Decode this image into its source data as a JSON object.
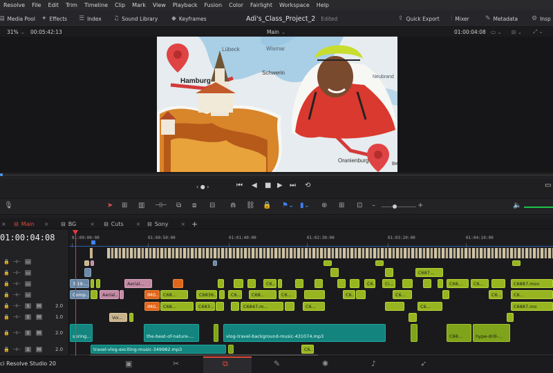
{
  "menu": [
    "Resolve",
    "File",
    "Edit",
    "Trim",
    "Timeline",
    "Clip",
    "Mark",
    "View",
    "Playback",
    "Fusion",
    "Color",
    "Fairlight",
    "Workspace",
    "Help"
  ],
  "toolbar": {
    "media_pool": "Media Pool",
    "effects": "Effects",
    "index": "Index",
    "sound_library": "Sound Library",
    "keyframes": "Keyframes",
    "project_name": "Adi's_Class_Project_2",
    "edited": "Edited",
    "quick_export": "Quick Export",
    "mixer": "Mixer",
    "metadata": "Metadata",
    "inspector": "Insp"
  },
  "viewer": {
    "zoom": "31%",
    "source_timecode": "00:05:42:13",
    "timeline_name": "Main",
    "record_timecode": "01:00:04:08"
  },
  "map": {
    "place_lubeck": "Lübeck",
    "place_wismar": "Wismar",
    "place_schwerin": "Schwerin",
    "place_hamburg": "Hamburg",
    "place_neubrandenburg": "Neubrand",
    "place_oranienburg": "Oranienburg",
    "place_be": "Be"
  },
  "tabs": [
    "Main",
    "BG",
    "Cuts",
    "Sony"
  ],
  "timeline": {
    "timecode": "01:00:04:08",
    "ruler": [
      "01:00:00:00",
      "01:00:50:00",
      "01:01:40:00",
      "01:02:30:00",
      "01:03:20:00",
      "01:04:10:00"
    ],
    "audio_levels": [
      "2.0",
      "1.0",
      "2.0",
      "2.0"
    ]
  },
  "clips": {
    "v3_1": "3 19-...",
    "v2_aerial": "Aerial...",
    "v2_c6": "C6...",
    "v2_ci": "Ci...",
    "v2_c6_b": "C6...",
    "v2_c68": "C68...",
    "v2_c6887": "C6887.mov",
    "v1_comp": "Comp...",
    "v1_aerial": "Aerial...",
    "v1_img": "IMG...",
    "v1_c68": "C68...",
    "v1_c6836": "C6836...",
    "v1_c6": "C6...",
    "v1_c68b": "C68...",
    "v1_c6c": "C6...",
    "v1_c6d": "C6...",
    "v1_c6e": "C6...",
    "v1_c6f": "C6...",
    "v1_c6g": "C6...",
    "a1_img": "IMG...",
    "a1_c68": "C68...",
    "a1_c683": "C683...",
    "a1_c6847": "C6847.m...",
    "a1_c6": "C6...",
    "a1_c6b": "C6...",
    "a1_c6887": "C6887.mo",
    "a2_voi": "Voi...",
    "a3_spring": "spring...",
    "a3_beat": "the-beat-of-nature-...",
    "a3_vlog": "vlog-travel-background-music-431074.mp3",
    "a3_c68": "C68...",
    "a3_hype": "hype-drill-...",
    "a4_travel": "travel-vlog-exciting-music-349982.mp3",
    "a4_c6": "C6..."
  },
  "top_strip": {
    "cam": "C687..."
  },
  "footer": {
    "app_name": "ci Resolve Studio 20"
  },
  "colors": {
    "accent_red": "#e53a3a",
    "video_clip": "#96b520",
    "audio_clip": "#13857e",
    "orange_clip": "#e0661c",
    "pink_clip": "#c48aa4"
  }
}
